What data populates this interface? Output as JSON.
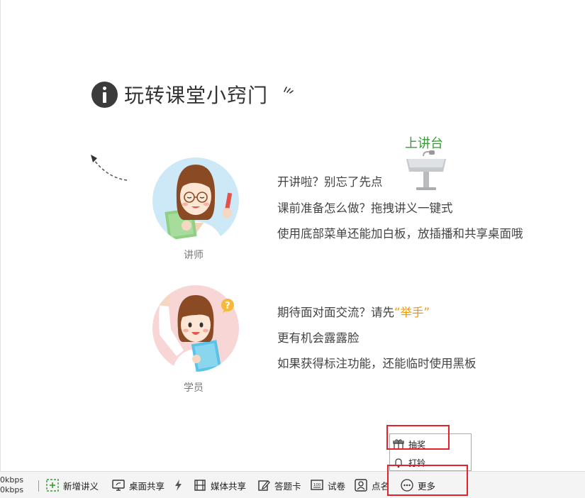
{
  "title": "玩转课堂小窍门",
  "teacher": {
    "label": "讲师",
    "tips": [
      "开讲啦？别忘了先点",
      "课前准备怎么做？拖拽讲义一键式",
      "使用底部菜单还能加白板，放插播和共享桌面哦"
    ],
    "podium_label": "上讲台"
  },
  "student": {
    "label": "学员",
    "tip1_prefix": "期待面对面交流？请先",
    "tip1_highlight": "“举手”",
    "tips": [
      "更有机会露露脸",
      "如果获得标注功能，还能临时使用黑板"
    ]
  },
  "popup": {
    "items": [
      "抽奖",
      "打铃"
    ]
  },
  "toolbar": {
    "bandwidth_up": "0kbps",
    "bandwidth_down": "0kbps",
    "new_handout": "新增讲义",
    "desktop_share": "桌面共享",
    "media_share": "媒体共享",
    "answer_card": "答题卡",
    "exam": "试卷",
    "roll_call": "点名",
    "more": "更多"
  },
  "colors": {
    "accent_green": "#3a9a3a",
    "highlight_orange": "#f39800",
    "annotation_red": "#e5212b"
  }
}
